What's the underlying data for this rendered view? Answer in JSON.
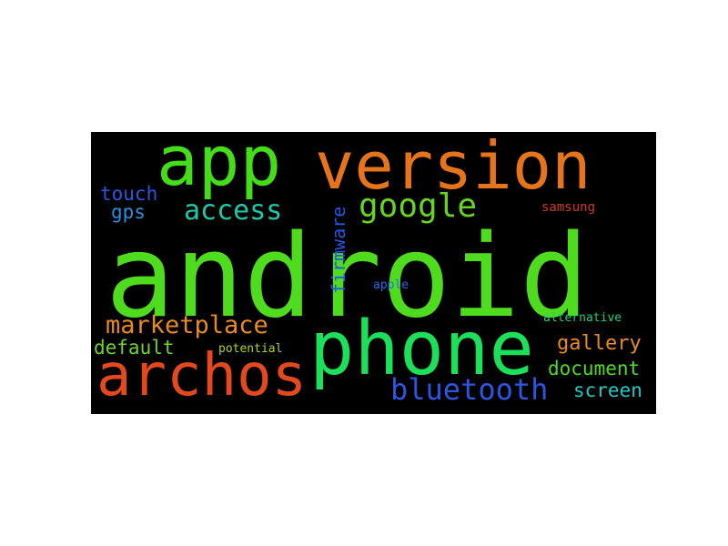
{
  "words": [
    {
      "text": "android",
      "color": "#4fdc1e"
    },
    {
      "text": "app",
      "color": "#45dc1a"
    },
    {
      "text": "version",
      "color": "#e6741a"
    },
    {
      "text": "phone",
      "color": "#1de05a"
    },
    {
      "text": "archos",
      "color": "#e4491e"
    },
    {
      "text": "google",
      "color": "#67d322"
    },
    {
      "text": "access",
      "color": "#1ec8a8"
    },
    {
      "text": "marketplace",
      "color": "#e88a22"
    },
    {
      "text": "bluetooth",
      "color": "#2c55e2"
    },
    {
      "text": "firmware",
      "color": "#2456e6"
    },
    {
      "text": "touch",
      "color": "#2a57e0"
    },
    {
      "text": "gps",
      "color": "#2a8fe0"
    },
    {
      "text": "samsung",
      "color": "#d23a1e"
    },
    {
      "text": "apple",
      "color": "#1e6fe6"
    },
    {
      "text": "alternative",
      "color": "#1ed07a"
    },
    {
      "text": "default",
      "color": "#6ed428"
    },
    {
      "text": "potential",
      "color": "#b2d224"
    },
    {
      "text": "gallery",
      "color": "#e88a22"
    },
    {
      "text": "document",
      "color": "#4fdc1e"
    },
    {
      "text": "screen",
      "color": "#1ec8c8"
    }
  ]
}
